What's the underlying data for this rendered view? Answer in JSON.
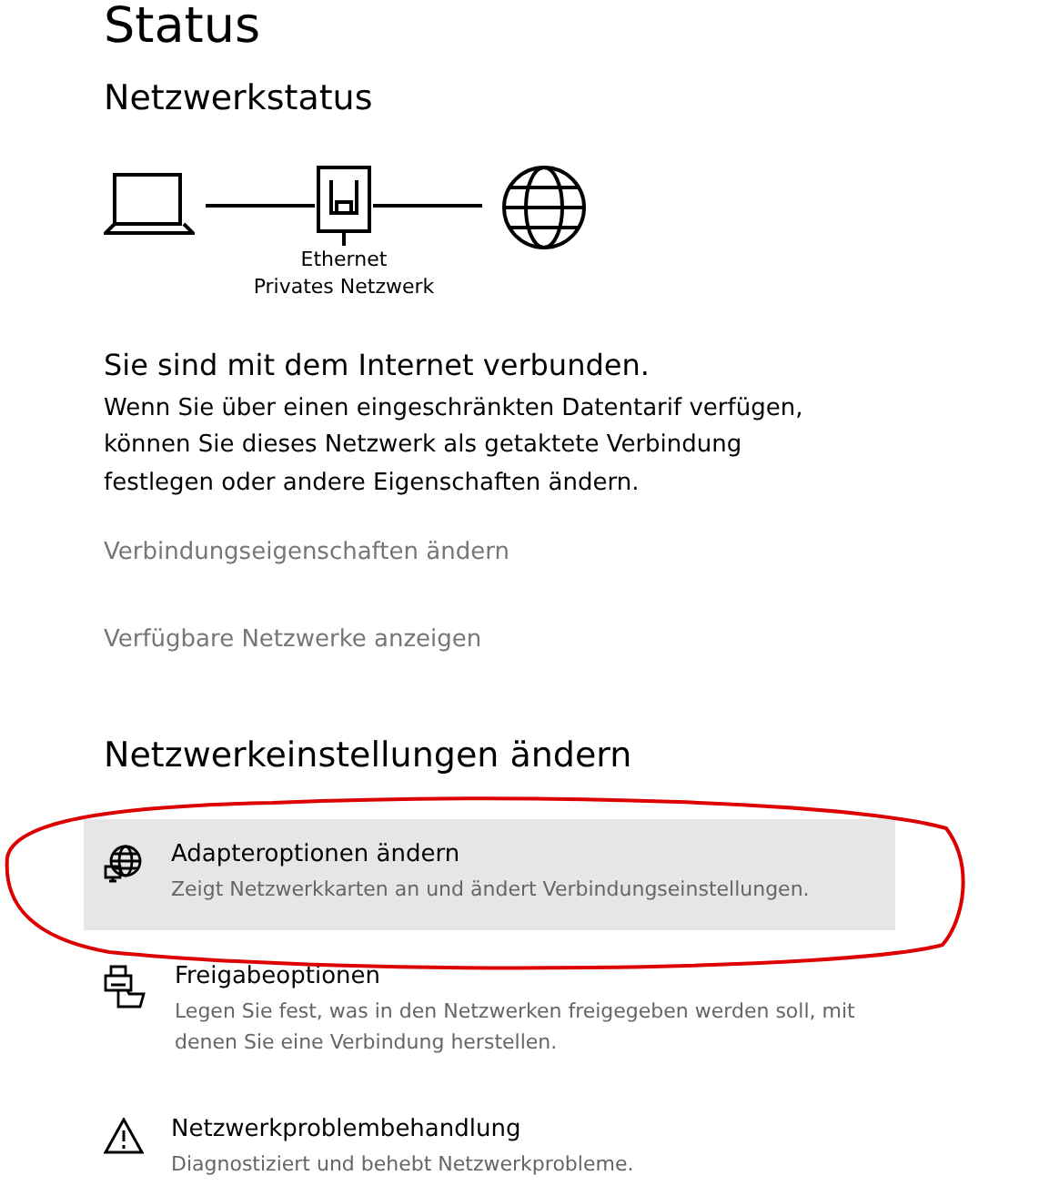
{
  "title": "Status",
  "network_status": {
    "heading": "Netzwerkstatus",
    "adapter_label": "Ethernet",
    "network_label": "Privates Netzwerk",
    "connection_title": "Sie sind mit dem Internet verbunden.",
    "connection_text": "Wenn Sie über einen eingeschränkten Datentarif verfügen, können Sie dieses Netzwerk als getaktete Verbindung festlegen oder andere Eigenschaften ändern."
  },
  "links": [
    "Verbindungseigenschaften ändern",
    "Verfügbare Netzwerke anzeigen"
  ],
  "settings": {
    "heading": "Netzwerkeinstellungen ändern",
    "items": [
      {
        "title": "Adapteroptionen ändern",
        "description": "Zeigt Netzwerkkarten an und ändert Verbindungseinstellungen.",
        "selected": true
      },
      {
        "title": "Freigabeoptionen",
        "description": "Legen Sie fest, was in den Netzwerken freigegeben werden soll, mit denen Sie eine Verbindung herstellen.",
        "selected": false
      },
      {
        "title": "Netzwerkproblembehandlung",
        "description": "Diagnostiziert und behebt Netzwerkprobleme.",
        "selected": false
      }
    ]
  }
}
